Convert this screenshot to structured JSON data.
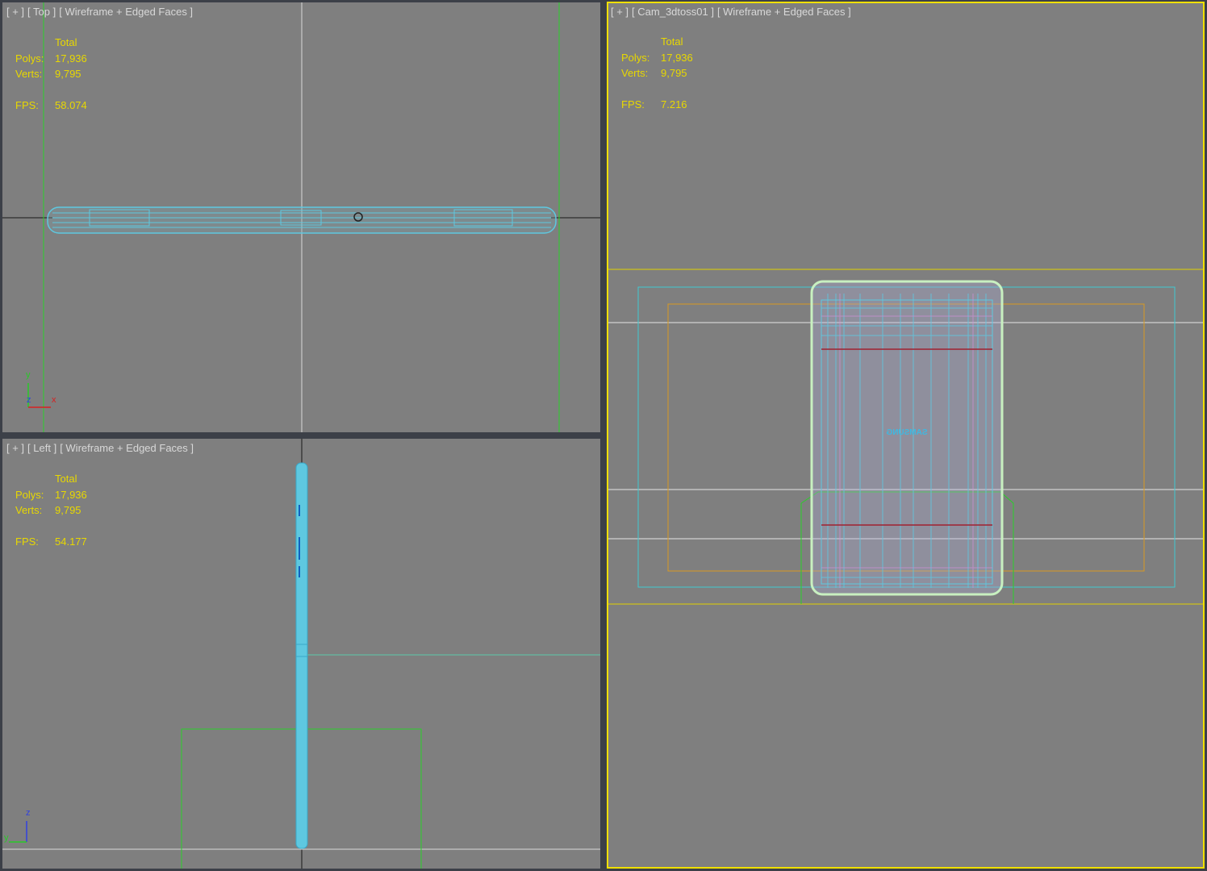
{
  "viewports": {
    "top": {
      "label_parts": [
        "[ + ]",
        "[ Top ]",
        "[ Wireframe + Edged Faces ]"
      ],
      "stats": {
        "header": "Total",
        "polys_label": "Polys:",
        "polys": "17,936",
        "verts_label": "Verts:",
        "verts": "9,795",
        "fps_label": "FPS:",
        "fps": "58.074"
      },
      "axes": {
        "a": "y",
        "b": "z",
        "c": "x"
      }
    },
    "left": {
      "label_parts": [
        "[ + ]",
        "[ Left ]",
        "[ Wireframe + Edged Faces ]"
      ],
      "stats": {
        "header": "Total",
        "polys_label": "Polys:",
        "polys": "17,936",
        "verts_label": "Verts:",
        "verts": "9,795",
        "fps_label": "FPS:",
        "fps": "54.177"
      },
      "axes": {
        "a": "z",
        "b": "y"
      }
    },
    "camera": {
      "label_parts": [
        "[ + ]",
        "[ Cam_3dtoss01 ]",
        "[ Wireframe + Edged Faces ]"
      ],
      "stats": {
        "header": "Total",
        "polys_label": "Polys:",
        "polys": "17,936",
        "verts_label": "Verts:",
        "verts": "9,795",
        "fps_label": "FPS:",
        "fps": "7.216"
      },
      "brand_text": "SAMSUNG"
    }
  },
  "colors": {
    "viewport_bg": "#7f7f7f",
    "active_border": "#f0e000",
    "stats_text": "#e8d800",
    "wire_cyan": "#5ec8e0",
    "wire_green": "#28d028",
    "grid_white": "#e6e6e6",
    "frame_orange": "#d89a20"
  }
}
